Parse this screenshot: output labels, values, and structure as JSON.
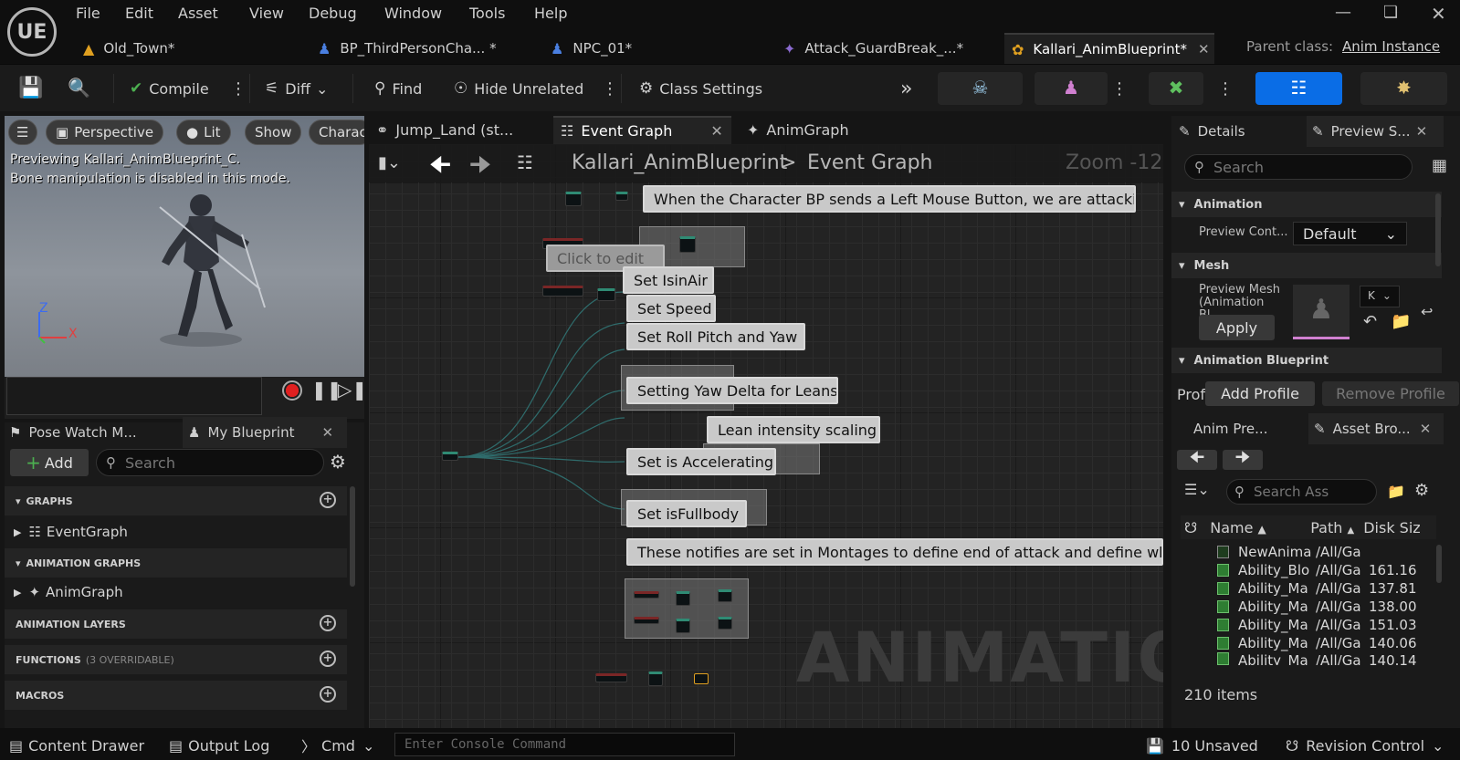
{
  "app": {
    "logo": "UE"
  },
  "menu": [
    "File",
    "Edit",
    "Asset",
    "View",
    "Debug",
    "Window",
    "Tools",
    "Help"
  ],
  "doc_tabs": [
    {
      "label": "Old_Town*",
      "icon": "level-icon"
    },
    {
      "label": "BP_ThirdPersonCha... *",
      "icon": "blueprint-pawn-icon"
    },
    {
      "label": "NPC_01*",
      "icon": "character-icon"
    },
    {
      "label": "Attack_GuardBreak_...*",
      "icon": "montage-icon"
    },
    {
      "label": "Kallari_AnimBlueprint*",
      "icon": "anim-blueprint-icon",
      "active": true
    }
  ],
  "parent_class": {
    "label": "Parent class:",
    "value": "Anim Instance"
  },
  "toolbar": {
    "compile": "Compile",
    "diff": "Diff",
    "find": "Find",
    "hide_unrelated": "Hide Unrelated",
    "class_settings": "Class Settings"
  },
  "viewport": {
    "perspective": "Perspective",
    "lit": "Lit",
    "show": "Show",
    "character": "Charac",
    "preview_text": "Previewing Kallari_AnimBlueprint_C.",
    "bone_text": "Bone manipulation is disabled in this mode.",
    "axis_z": "Z",
    "axis_x": "X"
  },
  "left_panel": {
    "tab_pose_watch": "Pose Watch M...",
    "tab_my_blueprint": "My Blueprint",
    "add": "Add",
    "search_placeholder": "Search",
    "graphs": "GRAPHS",
    "event_graph": "EventGraph",
    "animation_graphs": "ANIMATION GRAPHS",
    "anim_graph": "AnimGraph",
    "animation_layers": "ANIMATION LAYERS",
    "functions": "FUNCTIONS",
    "functions_overridable": "(3 OVERRIDABLE)",
    "macros": "MACROS"
  },
  "graph_tabs": [
    "Jump_Land (st...",
    "Event Graph",
    "AnimGraph"
  ],
  "graph": {
    "breadcrumb_root": "Kallari_AnimBlueprint",
    "breadcrumb_sep": ">",
    "breadcrumb_current": "Event Graph",
    "zoom": "Zoom -12",
    "watermark": "ANIMATION",
    "comments": [
      "When the Character BP sends a Left Mouse Button, we are attacking.",
      "Click to edit",
      "Set IsinAir",
      "Set Speed",
      "Set Roll Pitch and Yaw",
      "Setting Yaw Delta for Leans",
      "Lean intensity scaling",
      "Set is Accelerating",
      "Set isFullbody",
      "These notifies are set in Montages to define end of attack and define whe"
    ]
  },
  "details": {
    "tab_details": "Details",
    "tab_preview": "Preview S...",
    "search_placeholder": "Search",
    "sec_animation": "Animation",
    "preview_controller_label": "Preview Cont...",
    "preview_controller_value": "Default",
    "sec_mesh": "Mesh",
    "preview_mesh_label": "Preview Mesh (Animation Bl...",
    "apply": "Apply",
    "mesh_dropdown": "K",
    "sec_anim_bp": "Animation Blueprint",
    "profile_label": "Profil",
    "add_profile": "Add Profile",
    "remove_profile": "Remove Profile"
  },
  "asset_browser": {
    "tab_anim_preview": "Anim Pre...",
    "tab_asset_browser": "Asset Bro...",
    "search_placeholder": "Search Ass",
    "col_name": "Name",
    "col_path": "Path",
    "col_size": "Disk Siz",
    "rows": [
      {
        "name": "NewAnima",
        "path": "/All/Ga",
        "size": ""
      },
      {
        "name": "Ability_Blo",
        "path": "/All/Ga",
        "size": "161.16"
      },
      {
        "name": "Ability_Ma",
        "path": "/All/Ga",
        "size": "137.81"
      },
      {
        "name": "Ability_Ma",
        "path": "/All/Ga",
        "size": "138.00"
      },
      {
        "name": "Ability_Ma",
        "path": "/All/Ga",
        "size": "151.03"
      },
      {
        "name": "Ability_Ma",
        "path": "/All/Ga",
        "size": "140.06"
      },
      {
        "name": "Ability_Ma",
        "path": "/All/Ga",
        "size": "140.14"
      }
    ],
    "count": "210 items"
  },
  "statusbar": {
    "content_drawer": "Content Drawer",
    "output_log": "Output Log",
    "cmd": "Cmd",
    "console_placeholder": "Enter Console Command",
    "unsaved": "10 Unsaved",
    "revision_control": "Revision Control"
  }
}
